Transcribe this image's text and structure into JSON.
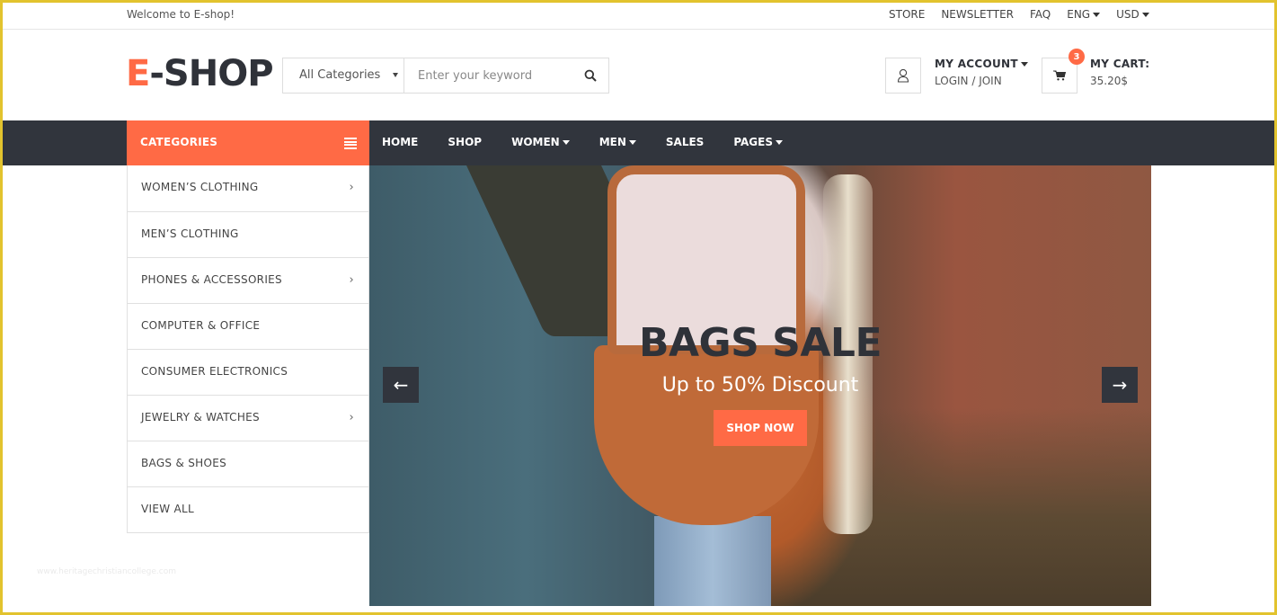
{
  "topbar": {
    "welcome": "Welcome to E-shop!",
    "links": [
      "STORE",
      "NEWSLETTER",
      "FAQ"
    ],
    "language": "ENG",
    "currency": "USD"
  },
  "header": {
    "logo_accent": "E",
    "logo_rest": "-SHOP",
    "search": {
      "category_selected": "All Categories",
      "placeholder": "Enter your keyword",
      "value": ""
    },
    "account": {
      "title": "MY ACCOUNT",
      "subtitle": "LOGIN / JOIN"
    },
    "cart": {
      "title": "MY CART:",
      "total": "35.20$",
      "count": "3"
    }
  },
  "nav": {
    "categories_label": "CATEGORIES",
    "links": [
      {
        "label": "HOME",
        "dropdown": false
      },
      {
        "label": "SHOP",
        "dropdown": false
      },
      {
        "label": "WOMEN",
        "dropdown": true
      },
      {
        "label": "MEN",
        "dropdown": true
      },
      {
        "label": "SALES",
        "dropdown": false
      },
      {
        "label": "PAGES",
        "dropdown": true
      }
    ]
  },
  "categories": [
    {
      "label": "WOMEN’S CLOTHING",
      "submenu": true
    },
    {
      "label": "MEN’S CLOTHING",
      "submenu": false
    },
    {
      "label": "PHONES & ACCESSORIES",
      "submenu": true
    },
    {
      "label": "COMPUTER & OFFICE",
      "submenu": false
    },
    {
      "label": "CONSUMER ELECTRONICS",
      "submenu": false
    },
    {
      "label": "JEWELRY & WATCHES",
      "submenu": true
    },
    {
      "label": "BAGS & SHOES",
      "submenu": false
    },
    {
      "label": "VIEW ALL",
      "submenu": false
    }
  ],
  "hero": {
    "title": "BAGS SALE",
    "subtitle": "Up to 50% Discount",
    "button": "SHOP NOW",
    "prev_arrow": "←",
    "next_arrow": "→"
  },
  "watermark": "www.heritagechristiancollege.com",
  "colors": {
    "accent": "#ff6a45",
    "dark": "#31353d",
    "frame": "#e2c32e"
  }
}
